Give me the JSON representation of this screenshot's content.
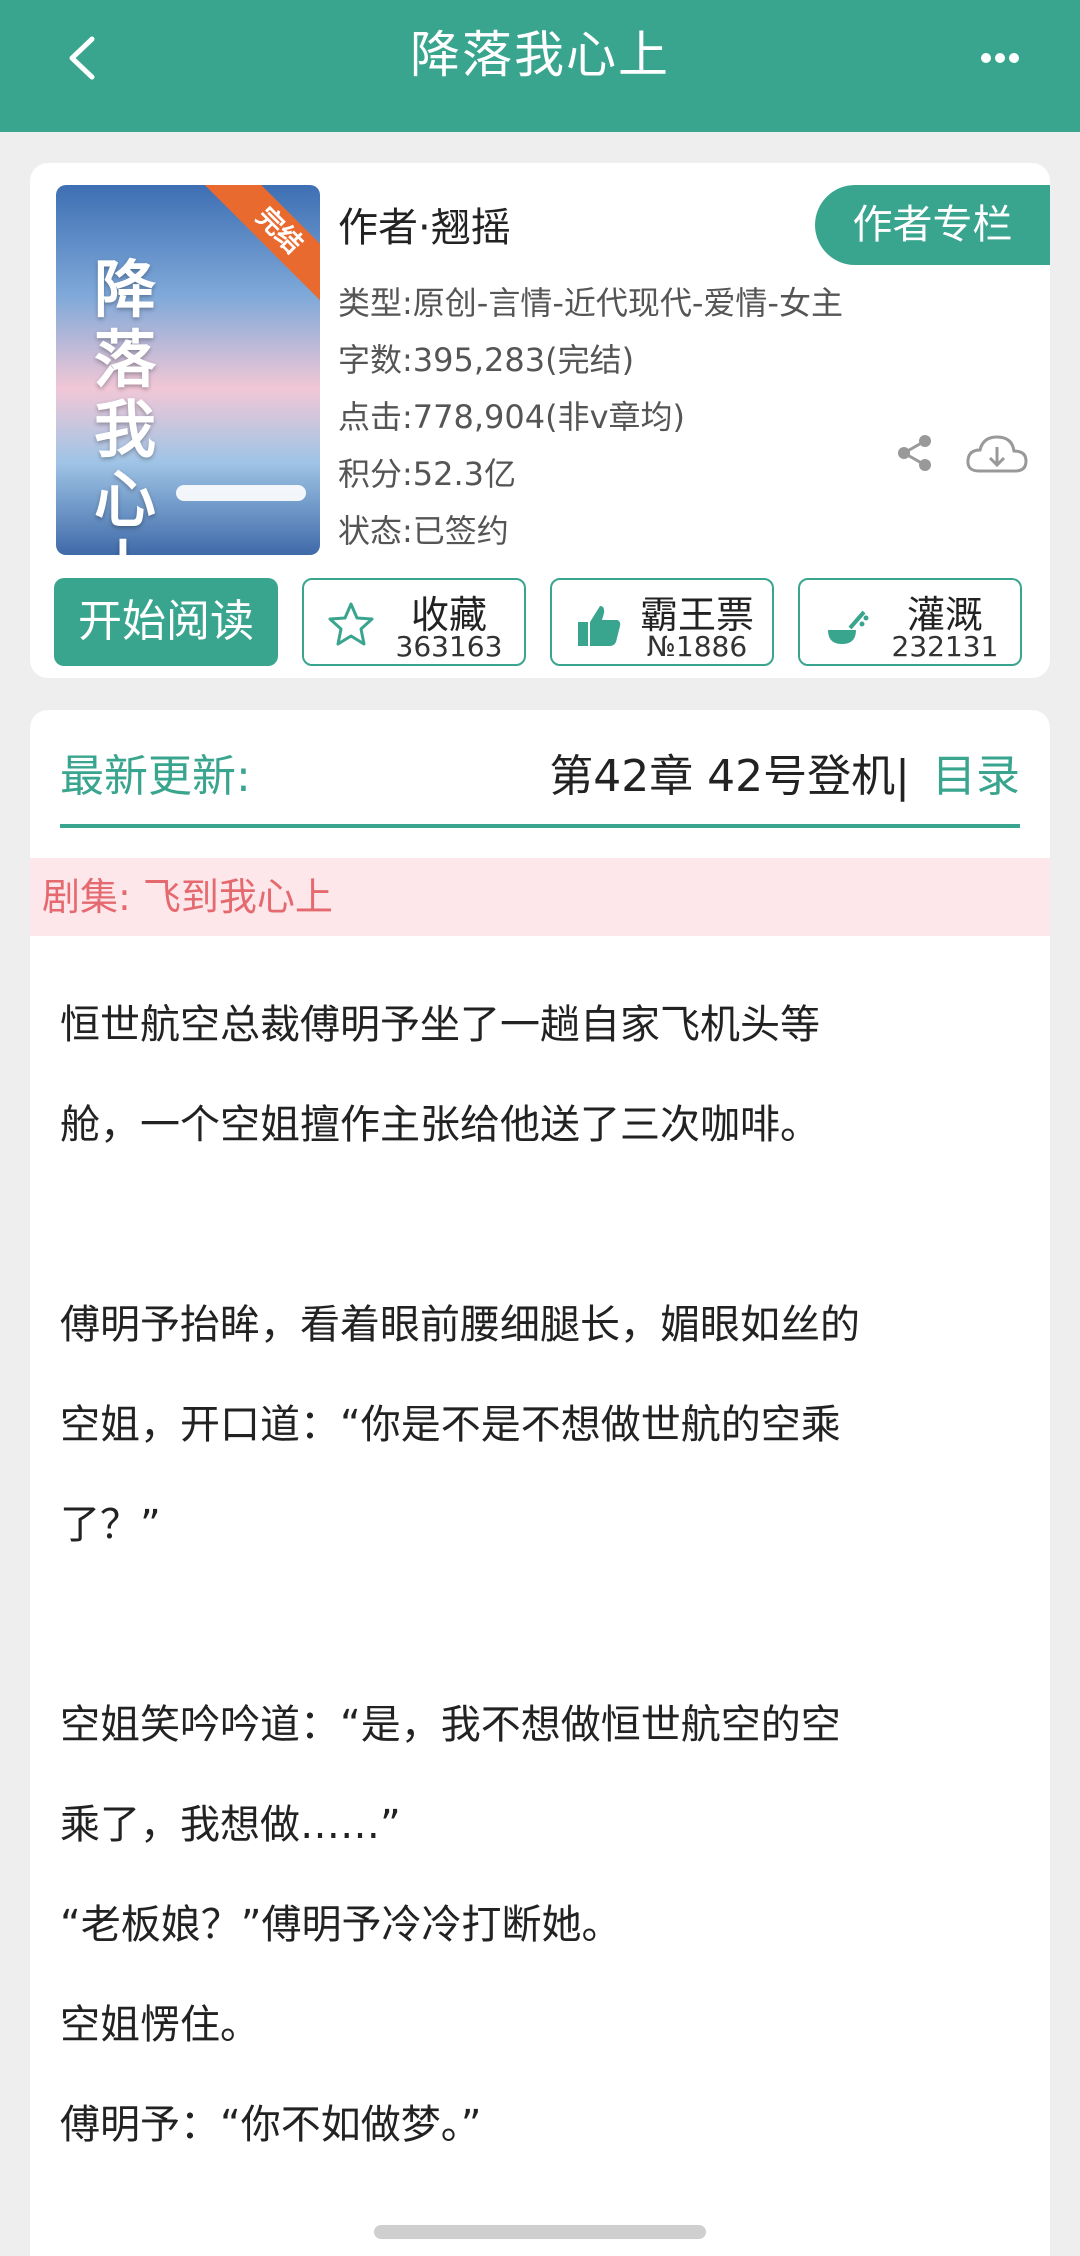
{
  "header": {
    "title": "降落我心上"
  },
  "book": {
    "cover_title": "降落我心上",
    "cover_badge": "完结",
    "author": "作者·翘摇",
    "author_column_label": "作者专栏",
    "type": "类型:原创-言情-近代现代-爱情-女主",
    "word_count": "字数:395,283(完结)",
    "clicks": "点击:778,904(非v章均)",
    "score": "积分:52.3亿",
    "status": "状态:已签约"
  },
  "actions": {
    "read_label": "开始阅读",
    "collect_label": "收藏",
    "collect_count": "363163",
    "ticket_label": "霸王票",
    "ticket_rank": "№1886",
    "water_label": "灌溉",
    "water_count": "232131"
  },
  "latest": {
    "label": "最新更新:",
    "chapter": "第42章 42号登机|",
    "toc_label": "目录"
  },
  "series": "剧集: 飞到我心上",
  "synopsis": [
    "恒世航空总裁傅明予坐了一趟自家飞机头等",
    "舱，一个空姐擅作主张给他送了三次咖啡。",
    "",
    "傅明予抬眸，看着眼前腰细腿长，媚眼如丝的",
    "空姐，开口道：“你是不是不想做世航的空乘",
    "了？”",
    "",
    "空姐笑吟吟道：“是，我不想做恒世航空的空",
    "乘了，我想做……”",
    "“老板娘？”傅明予冷冷打断她。",
    "空姐愣住。",
    "傅明予：“你不如做梦。”"
  ],
  "colors": {
    "accent": "#3aa58e",
    "series_bg": "#fde7ea",
    "series_text": "#e46a6f"
  }
}
